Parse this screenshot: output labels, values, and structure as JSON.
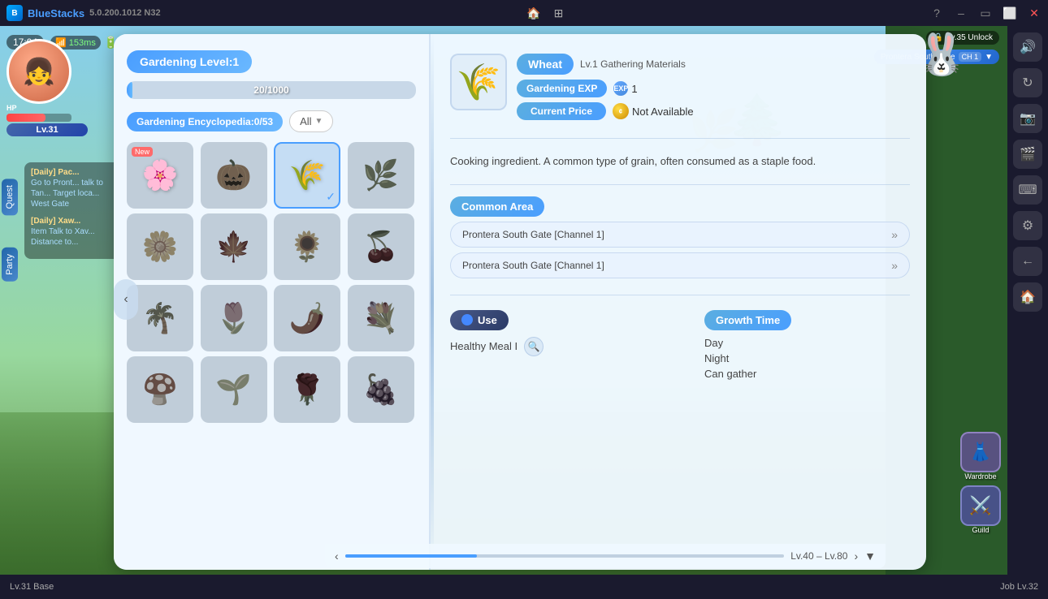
{
  "titlebar": {
    "app_name": "BlueStacks",
    "version": "5.0.200.1012 N32",
    "time": "17:04",
    "ping": "153ms",
    "home_tooltip": "Home",
    "minimize_label": "Minimize",
    "maximize_label": "Maximize",
    "close_label": "Close"
  },
  "bottom_bar": {
    "left_label": "Lv.31 Base",
    "right_label": "Job Lv.32"
  },
  "game": {
    "location": "Prontera South Gate",
    "channel": "CH 1",
    "unlock_level": "Lv.35 Unlock",
    "player_level": "Lv.31",
    "time": "17:04",
    "ping": "153ms"
  },
  "left_panel": {
    "gardening_level_label": "Gardening Level:1",
    "exp_current": "20",
    "exp_max": "1000",
    "exp_display": "20/1000",
    "encyclopedia_label": "Gardening Encyclopedia:0/53",
    "filter_label": "All",
    "items": [
      {
        "id": 0,
        "emoji": "🌸",
        "dimmed": false,
        "new": true,
        "selected": false,
        "name": "Crystal Flower"
      },
      {
        "id": 1,
        "emoji": "🎃",
        "dimmed": true,
        "new": false,
        "selected": false,
        "name": "Pumpkin"
      },
      {
        "id": 2,
        "emoji": "🌾",
        "dimmed": false,
        "new": false,
        "selected": true,
        "name": "Wheat"
      },
      {
        "id": 3,
        "emoji": "🌿",
        "dimmed": true,
        "new": false,
        "selected": false,
        "name": "Herb"
      },
      {
        "id": 4,
        "emoji": "🌼",
        "dimmed": true,
        "new": false,
        "selected": false,
        "name": "Small Flower"
      },
      {
        "id": 5,
        "emoji": "🍁",
        "dimmed": true,
        "new": false,
        "selected": false,
        "name": "Red Leaf"
      },
      {
        "id": 6,
        "emoji": "🌻",
        "dimmed": true,
        "new": false,
        "selected": false,
        "name": "Sunflower"
      },
      {
        "id": 7,
        "emoji": "🍒",
        "dimmed": true,
        "new": false,
        "selected": false,
        "name": "Berries"
      },
      {
        "id": 8,
        "emoji": "🌴",
        "dimmed": true,
        "new": false,
        "selected": false,
        "name": "Palm"
      },
      {
        "id": 9,
        "emoji": "🌷",
        "dimmed": true,
        "new": false,
        "selected": false,
        "name": "Tulip"
      },
      {
        "id": 10,
        "emoji": "🌶️",
        "dimmed": true,
        "new": false,
        "selected": false,
        "name": "Chili"
      },
      {
        "id": 11,
        "emoji": "💐",
        "dimmed": true,
        "new": false,
        "selected": false,
        "name": "Bouquet"
      },
      {
        "id": 12,
        "emoji": "🍄",
        "dimmed": true,
        "new": false,
        "selected": false,
        "name": "Mushroom"
      },
      {
        "id": 13,
        "emoji": "🌱",
        "dimmed": true,
        "new": false,
        "selected": false,
        "name": "Sprout"
      },
      {
        "id": 14,
        "emoji": "🌹",
        "dimmed": true,
        "new": false,
        "selected": false,
        "name": "Rose"
      },
      {
        "id": 15,
        "emoji": "🍇",
        "dimmed": true,
        "new": false,
        "selected": false,
        "name": "Grapes"
      }
    ]
  },
  "right_panel": {
    "item_name": "Wheat",
    "item_emoji": "🌾",
    "item_type": "Lv.1 Gathering Materials",
    "gardening_exp_label": "Gardening EXP",
    "gardening_exp_value": "1",
    "current_price_label": "Current Price",
    "current_price_value": "Not Available",
    "description": "Cooking ingredient. A common type of grain, often consumed as a staple food.",
    "common_area_label": "Common Area",
    "locations": [
      "Prontera South Gate [Channel 1]",
      "Prontera South Gate [Channel 1]"
    ],
    "use_label": "Use",
    "growth_time_label": "Growth Time",
    "use_item": "Healthy Meal I",
    "growth_times": [
      "Day",
      "Night",
      "Can gather"
    ]
  },
  "slider": {
    "label": "Lv.40 – Lv.80"
  },
  "quests": [
    {
      "title": "[Daily] Pac...",
      "text": "Go to Pront... talk to Tan... Target loca... West Gate"
    },
    {
      "title": "[Daily] Xaw...",
      "text": "Item Talk to Xav... Distance to..."
    }
  ],
  "side_buttons": [
    "Quest",
    "Party"
  ]
}
